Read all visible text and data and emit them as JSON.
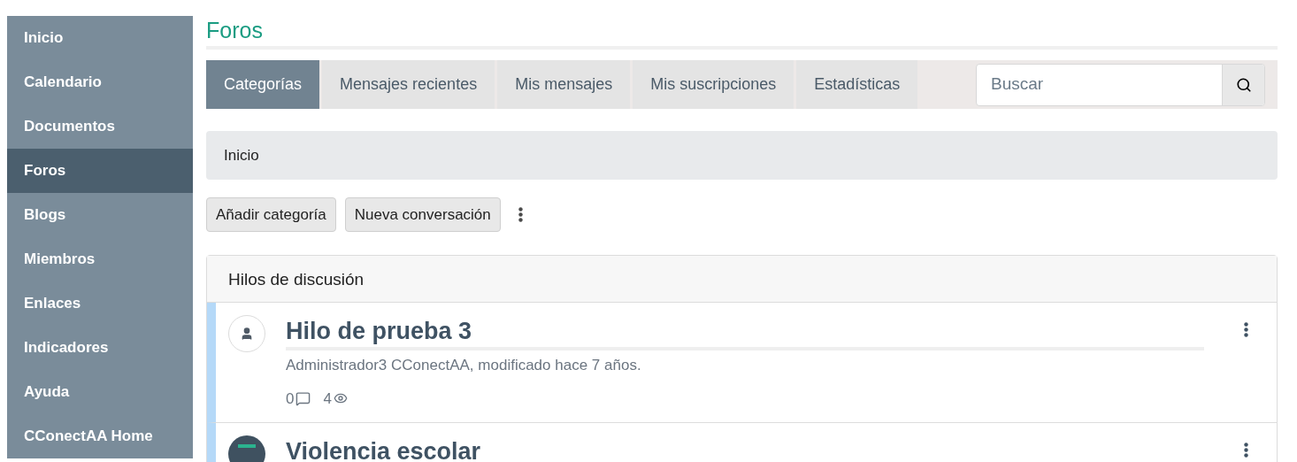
{
  "sidebar": {
    "items": [
      {
        "label": "Inicio",
        "selected": false
      },
      {
        "label": "Calendario",
        "selected": false
      },
      {
        "label": "Documentos",
        "selected": false
      },
      {
        "label": "Foros",
        "selected": true
      },
      {
        "label": "Blogs",
        "selected": false
      },
      {
        "label": "Miembros",
        "selected": false
      },
      {
        "label": "Enlaces",
        "selected": false
      },
      {
        "label": "Indicadores",
        "selected": false
      },
      {
        "label": "Ayuda",
        "selected": false
      },
      {
        "label": "CConectAA Home",
        "selected": false
      }
    ]
  },
  "page_title": "Foros",
  "tabs": [
    {
      "label": "Categorías",
      "selected": true
    },
    {
      "label": "Mensajes recientes",
      "selected": false
    },
    {
      "label": "Mis mensajes",
      "selected": false
    },
    {
      "label": "Mis suscripciones",
      "selected": false
    },
    {
      "label": "Estadísticas",
      "selected": false
    }
  ],
  "search": {
    "placeholder": "Buscar"
  },
  "breadcrumb": [
    "Inicio"
  ],
  "actions": [
    "Añadir categoría",
    "Nueva conversación"
  ],
  "threads_panel": {
    "title": "Hilos de discusión",
    "threads": [
      {
        "kind": "person",
        "title": "Hilo de prueba 3",
        "meta": "Administrador3 CConectAA, modificado hace 7 años.",
        "replies": "0",
        "views": "4"
      },
      {
        "kind": "logo",
        "title": "Violencia escolar"
      }
    ]
  }
}
